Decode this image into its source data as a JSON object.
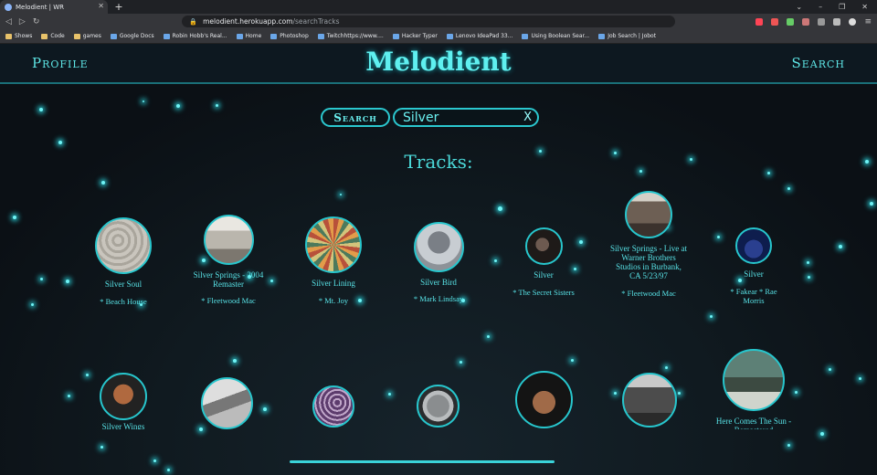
{
  "browser": {
    "tab_title": "Melodient | WR",
    "new_tab": "+",
    "url_host": "melodient.herokuapp.com",
    "url_path": "/searchTracks",
    "bookmarks": [
      "Shows",
      "Code",
      "games",
      "Google Docs",
      "Robin Hobb's Real...",
      "Home",
      "Photoshop",
      "Twitchhttps://www....",
      "Hacker Typer",
      "Lenovo IdeaPad 33...",
      "Using Boolean Sear...",
      "Job Search | Jobot"
    ]
  },
  "nav": {
    "profile": "Profile",
    "brand": "Melodient",
    "search": "Search"
  },
  "search": {
    "button": "Search",
    "query": "Silver",
    "clear": "X"
  },
  "results_heading": "Tracks:",
  "tracks": [
    {
      "title": "Silver Soul",
      "artist": "* Beach House"
    },
    {
      "title": "Silver Springs - 2004 Remaster",
      "artist": "* Fleetwood Mac"
    },
    {
      "title": "Silver Lining",
      "artist": "* Mt. Joy"
    },
    {
      "title": "Silver Bird",
      "artist": "* Mark Lindsay"
    },
    {
      "title": "Silver",
      "artist": "* The Secret Sisters"
    },
    {
      "title": "Silver Springs - Live at Warner Brothers Studios in Burbank, CA 5/23/97",
      "artist": "* Fleetwood Mac"
    },
    {
      "title": "Silver",
      "artist": "* Fakear * Rae Morris"
    },
    {
      "title": "Silver Wings",
      "artist": ""
    },
    {
      "title": "",
      "artist": ""
    },
    {
      "title": "",
      "artist": ""
    },
    {
      "title": "",
      "artist": ""
    },
    {
      "title": "",
      "artist": ""
    },
    {
      "title": "",
      "artist": ""
    },
    {
      "title": "Here Comes The Sun - Remastered",
      "artist": ""
    }
  ],
  "colors": {
    "accent": "#2bc8cf",
    "text": "#58e2e6",
    "background": "#0c1116"
  }
}
